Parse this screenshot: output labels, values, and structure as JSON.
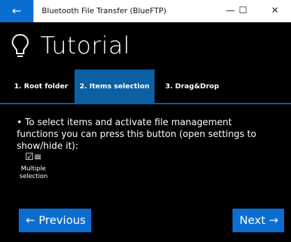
{
  "window": {
    "title": "Bluetooth File Transfer (BlueFTP)",
    "back_icon": "←",
    "minimize_icon": "—",
    "maximize_icon": "☐",
    "close_icon": "✕"
  },
  "hero": {
    "title": "Tutorial"
  },
  "tabs": [
    {
      "label": "1. Root folder",
      "selected": false
    },
    {
      "label": "2. Items selection",
      "selected": true
    },
    {
      "label": "3. Drag&Drop",
      "selected": false
    }
  ],
  "content": {
    "description": "• To select items and activate file management functions you can press this button (open settings to show/hide it):",
    "multi_icon": "☑≡",
    "multi_label_line1": "Multiple",
    "multi_label_line2": "selection"
  },
  "nav": {
    "previous_label": "← Previous",
    "next_label": "Next →"
  },
  "colors": {
    "accent": "#0a6ed1",
    "tab_selected": "#0b5fa3",
    "background": "#000000"
  }
}
